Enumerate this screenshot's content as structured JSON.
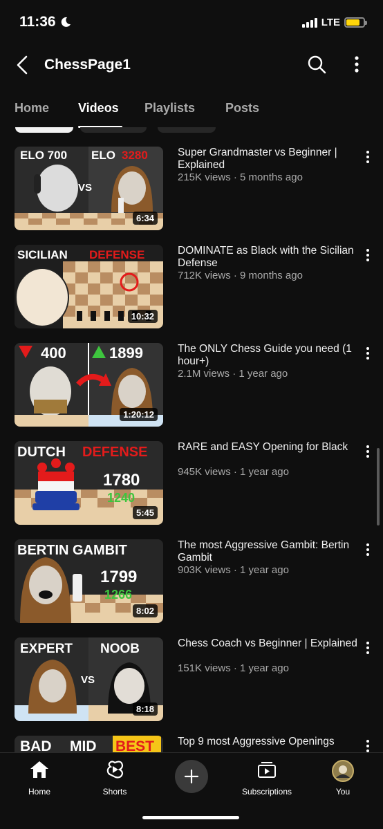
{
  "status": {
    "time": "11:36",
    "network": "LTE",
    "moon_icon": "moon-icon"
  },
  "header": {
    "title": "ChessPage1"
  },
  "tabs": [
    {
      "label": "Home"
    },
    {
      "label": "Videos"
    },
    {
      "label": "Playlists"
    },
    {
      "label": "Posts"
    }
  ],
  "videos": [
    {
      "title": "Super Grandmaster vs Beginner | Explained",
      "meta": "215K views · 5 months ago",
      "duration": "6:34",
      "thumb_text": [
        "ELO 700",
        "ELO",
        "3280",
        "VS"
      ]
    },
    {
      "title": "DOMINATE as Black with the Sicilian Defense",
      "meta": "712K views · 9 months ago",
      "duration": "10:32",
      "thumb_text": [
        "SICILIAN",
        "DEFENSE"
      ]
    },
    {
      "title": "The ONLY Chess Guide you need (1 hour+)",
      "meta": "2.1M views · 1 year ago",
      "duration": "1:20:12",
      "thumb_text": [
        "400",
        "1899"
      ]
    },
    {
      "title": "RARE and EASY Opening for Black",
      "meta": "945K views · 1 year ago",
      "duration": "5:45",
      "thumb_text": [
        "DUTCH",
        "DEFENSE",
        "1780",
        "1240"
      ]
    },
    {
      "title": "The most Aggressive Gambit: Bertin Gambit",
      "meta": "903K views · 1 year ago",
      "duration": "8:02",
      "thumb_text": [
        "BERTIN GAMBIT",
        "1799",
        "1266"
      ]
    },
    {
      "title": "Chess Coach vs Beginner | Explained",
      "meta": "151K views · 1 year ago",
      "duration": "8:18",
      "thumb_text": [
        "EXPERT",
        "NOOB",
        "VS"
      ]
    },
    {
      "title": "Top 9 most Aggressive Openings",
      "meta": "",
      "duration": "",
      "thumb_text": [
        "BAD",
        "MID",
        "BEST"
      ]
    }
  ],
  "nav": {
    "home": "Home",
    "shorts": "Shorts",
    "subscriptions": "Subscriptions",
    "you": "You"
  },
  "colors": {
    "background": "#0f0f0f",
    "accent_red": "#e31b1b",
    "meta_gray": "#aaaaaa",
    "battery": "#ffd60a"
  }
}
